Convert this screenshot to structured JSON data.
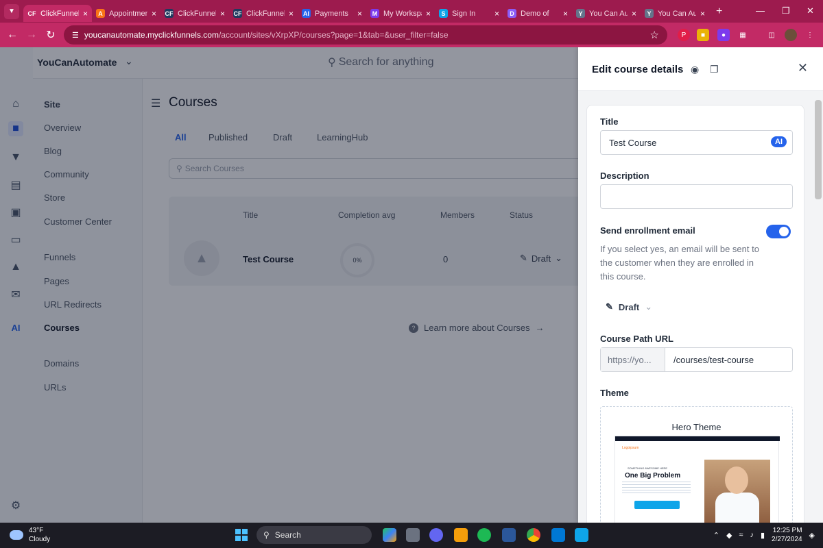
{
  "browser": {
    "tabs": [
      {
        "label": "ClickFunnels",
        "fav": "CF",
        "color": "#c22a65",
        "active": true
      },
      {
        "label": "Appointments",
        "fav": "A",
        "color": "#f97316"
      },
      {
        "label": "ClickFunnels",
        "fav": "CF",
        "color": "#1e3a5f"
      },
      {
        "label": "ClickFunnels",
        "fav": "CF",
        "color": "#1e3a5f"
      },
      {
        "label": "Payments",
        "fav": "AI",
        "color": "#2563eb"
      },
      {
        "label": "My Workspace",
        "fav": "M",
        "color": "#7c3aed"
      },
      {
        "label": "Sign In",
        "fav": "S",
        "color": "#0ea5e9"
      },
      {
        "label": "Demo of",
        "fav": "D",
        "color": "#8b5cf6"
      },
      {
        "label": "You Can Au",
        "fav": "Y",
        "color": "#64748b"
      },
      {
        "label": "You Can Au",
        "fav": "Y",
        "color": "#64748b"
      }
    ],
    "url_host": "youcanautomate.myclickfunnels.com",
    "url_path": "/account/sites/vXrpXP/courses?page=1&tab=&user_filter=false"
  },
  "app": {
    "org_name": "YouCanAutomate",
    "search_placeholder": "Search for anything"
  },
  "sidebar": {
    "heading": "Site",
    "items": [
      "Overview",
      "Blog",
      "Community",
      "Store",
      "Customer Center",
      "Funnels",
      "Pages",
      "URL Redirects",
      "Courses",
      "Domains",
      "URLs"
    ],
    "active": "Courses"
  },
  "main": {
    "title": "Courses",
    "tabs": [
      "All",
      "Published",
      "Draft",
      "LearningHub"
    ],
    "search_placeholder": "Search Courses",
    "columns": [
      "Title",
      "Completion avg",
      "Members",
      "Status"
    ],
    "row": {
      "title": "Test Course",
      "completion": "0%",
      "members": "0",
      "status": "Draft"
    },
    "learn_more": "Learn more about Courses"
  },
  "panel": {
    "title": "Edit course details",
    "title_label": "Title",
    "title_value": "Test Course",
    "ai_badge": "AI",
    "description_label": "Description",
    "description_value": "",
    "enroll_label": "Send enrollment email",
    "enroll_on": true,
    "enroll_help": "If you select yes, an email will be sent to the customer when they are enrolled in this course.",
    "status": "Draft",
    "path_label": "Course Path URL",
    "path_prefix": "https://yo...",
    "path_value": "/courses/test-course",
    "theme_label": "Theme",
    "theme_name": "Hero Theme",
    "theme_headline": "One Big Problem",
    "theme_eyebrow": "SOMETHING AWESOME HERE",
    "theme_logo": "Logoipsum"
  },
  "taskbar": {
    "temp": "43°F",
    "condition": "Cloudy",
    "search": "Search",
    "time": "12:25 PM",
    "date": "2/27/2024"
  },
  "colors": {
    "accent": "#2563eb",
    "chrome": "#c22a65"
  }
}
